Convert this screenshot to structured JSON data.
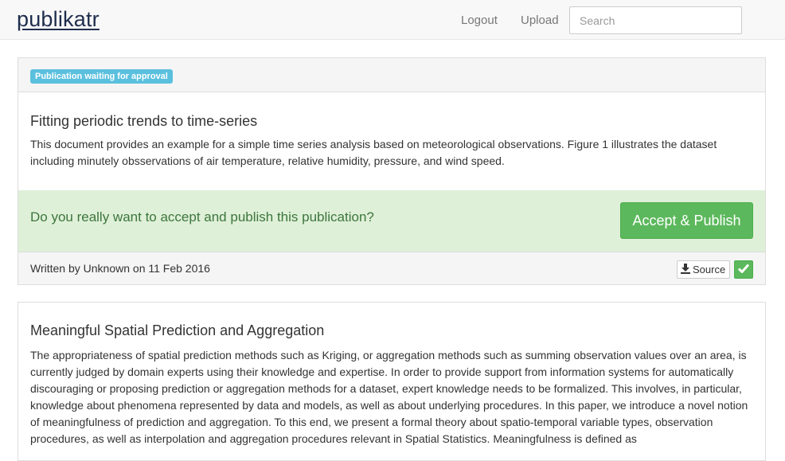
{
  "navbar": {
    "brand": "publikatr",
    "logout_label": "Logout",
    "upload_label": "Upload",
    "search_placeholder": "Search"
  },
  "publications": [
    {
      "status_badge": "Publication waiting for approval",
      "title": "Fitting periodic trends to time-series",
      "abstract": "This document provides an example for a simple time series analysis based on meteorological observations. Figure 1 illustrates the dataset including minutely obsservations of air temperature, relative humidity, pressure, and wind speed.",
      "confirm_question": "Do you really want to accept and publish this publication?",
      "accept_label": "Accept & Publish",
      "footer_text": "Written by Unknown on 11 Feb 2016",
      "source_label": "Source"
    },
    {
      "title": "Meaningful Spatial Prediction and Aggregation",
      "abstract": "The appropriateness of spatial prediction methods such as Kriging, or aggregation methods such as summing observation values over an area, is currently judged by domain experts using their knowledge and expertise. In order to provide support from information systems for automatically discouraging or proposing prediction or aggregation methods for a dataset, expert knowledge needs to be formalized. This involves, in particular, knowledge about phenomena represented by data and models, as well as about underlying procedures. In this paper, we introduce a novel notion of meaningfulness of prediction and aggregation. To this end, we present a formal theory about spatio-temporal variable types, observation procedures, as well as interpolation and aggregation procedures relevant in Spatial Statistics. Meaningfulness is defined as"
    }
  ],
  "colors": {
    "success": "#5cb85c",
    "info_badge": "#5bc0de",
    "confirm_bg": "#dff0d8",
    "confirm_text": "#3c763d"
  },
  "icons": [
    "download-icon",
    "checkmark-icon"
  ]
}
